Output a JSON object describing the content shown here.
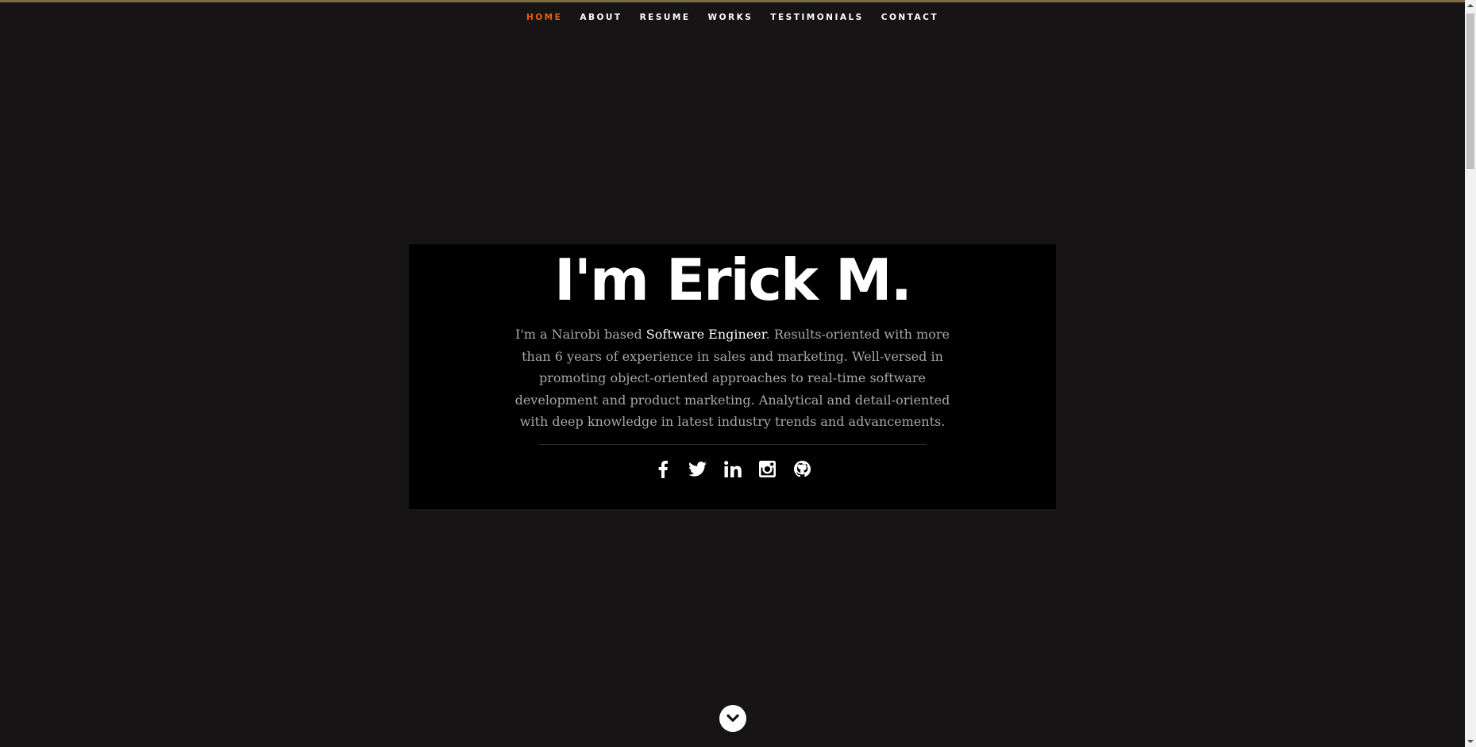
{
  "nav": {
    "items": [
      {
        "label": "HOME",
        "current": true
      },
      {
        "label": "ABOUT",
        "current": false
      },
      {
        "label": "RESUME",
        "current": false
      },
      {
        "label": "WORKS",
        "current": false
      },
      {
        "label": "TESTIMONIALS",
        "current": false
      },
      {
        "label": "CONTACT",
        "current": false
      }
    ]
  },
  "hero": {
    "title": "I'm Erick M.",
    "intro_before": "I'm a Nairobi based ",
    "intro_highlight": "Software Engineer",
    "intro_after": ". Results-oriented with more than 6 years of experience in sales and marketing. Well-versed in promoting object-oriented approaches to real-time software development and product marketing. Analytical and detail-oriented with deep knowledge in latest industry trends and advancements."
  },
  "social": {
    "icons": [
      "facebook-icon",
      "twitter-icon",
      "linkedin-icon",
      "instagram-icon",
      "github-icon"
    ]
  },
  "colors": {
    "background": "#161415",
    "hero_background": "#000000",
    "nav_active": "#f06000",
    "top_line": "#7a6a45"
  }
}
